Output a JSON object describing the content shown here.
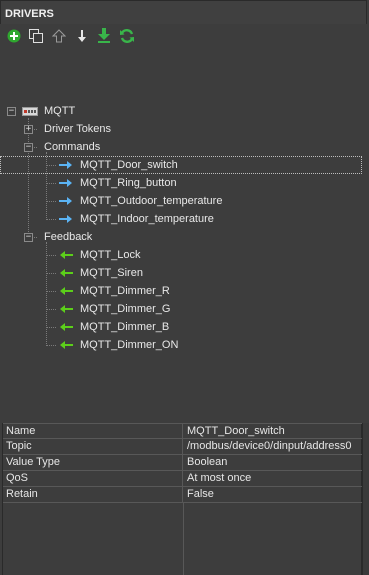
{
  "panel": {
    "title": "DRIVERS"
  },
  "toolbar": [
    {
      "icon": "add-green-circle",
      "color": "#2fa82f"
    },
    {
      "icon": "copy"
    },
    {
      "icon": "move-up"
    },
    {
      "icon": "move-down"
    },
    {
      "icon": "download-green",
      "color": "#39b54a"
    },
    {
      "icon": "refresh-green",
      "color": "#39b54a"
    }
  ],
  "tree": {
    "root": {
      "label": "MQTT",
      "icon": "device-icon"
    },
    "driver_tokens": {
      "label": "Driver Tokens"
    },
    "commands": {
      "label": "Commands",
      "items": [
        "MQTT_Door_switch",
        "MQTT_Ring_button",
        "MQTT_Outdoor_temperature",
        "MQTT_Indoor_temperature"
      ]
    },
    "feedback": {
      "label": "Feedback",
      "items": [
        "MQTT_Lock",
        "MQTT_Siren",
        "MQTT_Dimmer_R",
        "MQTT_Dimmer_G",
        "MQTT_Dimmer_B",
        "MQTT_Dimmer_ON"
      ]
    },
    "selected": "MQTT_Door_switch"
  },
  "colors": {
    "command_arrow": "#5bb4f5",
    "feedback_arrow": "#5ccf1a"
  },
  "properties": [
    {
      "name": "Name",
      "value": "MQTT_Door_switch"
    },
    {
      "name": "Topic",
      "value": "/modbus/device0/dinput/address0"
    },
    {
      "name": "Value Type",
      "value": "Boolean"
    },
    {
      "name": "QoS",
      "value": "At most once"
    },
    {
      "name": "Retain",
      "value": "False"
    }
  ]
}
